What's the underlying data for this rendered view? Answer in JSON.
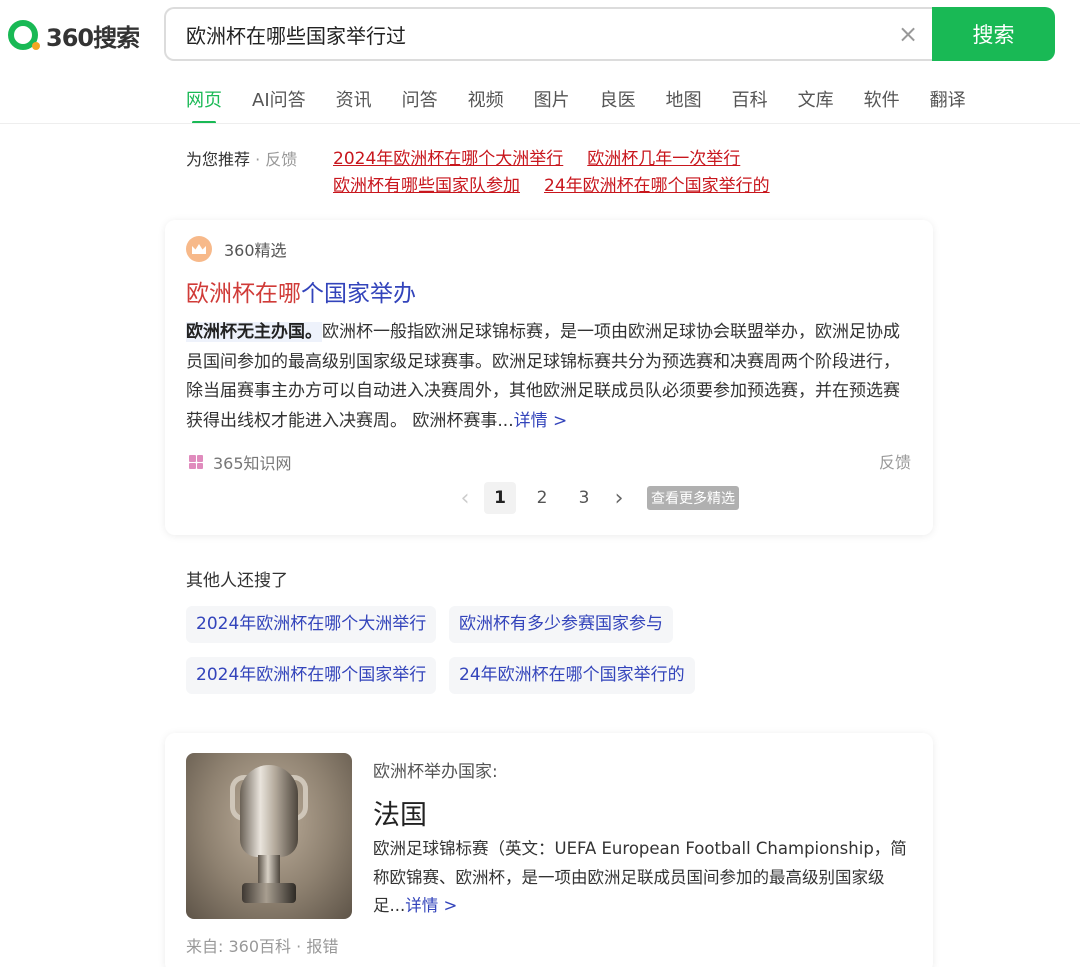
{
  "header": {
    "logo_text": "360搜索",
    "query": "欧洲杯在哪些国家举行过",
    "clear_icon": "×",
    "search_button": "搜索"
  },
  "tabs": [
    {
      "label": "网页",
      "active": true
    },
    {
      "label": "AI问答"
    },
    {
      "label": "资讯"
    },
    {
      "label": "问答"
    },
    {
      "label": "视频"
    },
    {
      "label": "图片"
    },
    {
      "label": "良医"
    },
    {
      "label": "地图"
    },
    {
      "label": "百科"
    },
    {
      "label": "文库"
    },
    {
      "label": "软件"
    },
    {
      "label": "翻译"
    }
  ],
  "recommend": {
    "label": "为您推荐",
    "sep": "·",
    "feedback": "反馈",
    "links": [
      "2024年欧洲杯在哪个大洲举行",
      "欧洲杯几年一次举行",
      "欧洲杯有哪些国家队参加",
      "24年欧洲杯在哪个国家举行的"
    ]
  },
  "featured": {
    "badge": "360精选",
    "title_hl": "欧洲杯在哪",
    "title_rest": "个国家举办",
    "body_strong": "欧洲杯无主办国。",
    "body_text": "欧洲杯一般指欧洲足球锦标赛，是一项由欧洲足球协会联盟举办，欧洲足协成员国间参加的最高级别国家级足球赛事。欧洲足球锦标赛共分为预选赛和决赛周两个阶段进行，除当届赛事主办方可以自动进入决赛周外，其他欧洲足联成员队必须要参加预选赛，并在预选赛获得出线权才能进入决赛周。 欧洲杯赛事...",
    "detail": "详情 >",
    "source": "365知识网",
    "feedback": "反馈",
    "pager": {
      "prev": "‹",
      "pages": [
        "1",
        "2",
        "3"
      ],
      "current": "1",
      "next": "›",
      "more": "查看更多精选"
    }
  },
  "others": {
    "title": "其他人还搜了",
    "chips": [
      "2024年欧洲杯在哪个大洲举行",
      "欧洲杯有多少参赛国家参与",
      "2024年欧洲杯在哪个国家举行",
      "24年欧洲杯在哪个国家举行的"
    ]
  },
  "baike": {
    "label": "欧洲杯举办国家:",
    "value": "法国",
    "desc": "欧洲足球锦标赛（英文：UEFA European Football Championship，简称欧锦赛、欧洲杯，是一项由欧洲足联成员国间参加的最高级别国家级足...",
    "detail": "详情 >",
    "source_label": "来自: 360百科",
    "sep": "·",
    "report": "报错"
  }
}
